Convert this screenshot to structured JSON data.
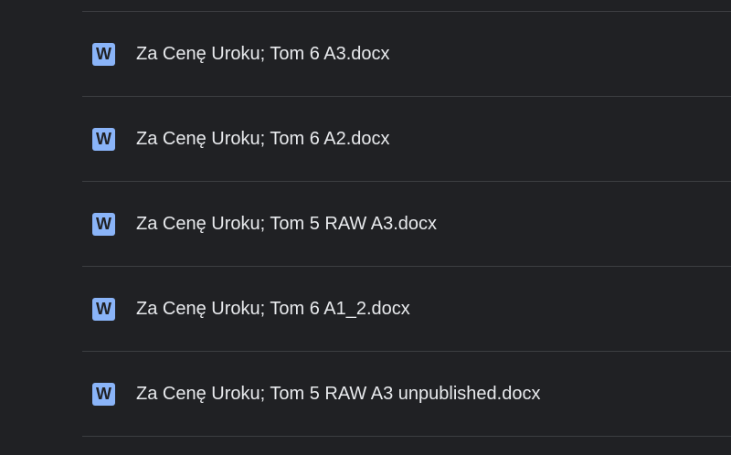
{
  "files": [
    {
      "name": "Za Cenę Uroku; Tom 6 A3.docx",
      "icon": "word-doc-icon",
      "icon_letter": "W"
    },
    {
      "name": "Za Cenę Uroku; Tom 6 A2.docx",
      "icon": "word-doc-icon",
      "icon_letter": "W"
    },
    {
      "name": "Za Cenę Uroku; Tom 5 RAW A3.docx",
      "icon": "word-doc-icon",
      "icon_letter": "W"
    },
    {
      "name": "Za Cenę Uroku; Tom 6 A1_2.docx",
      "icon": "word-doc-icon",
      "icon_letter": "W"
    },
    {
      "name": "Za Cenę Uroku; Tom 5 RAW A3 unpublished.docx",
      "icon": "word-doc-icon",
      "icon_letter": "W"
    }
  ],
  "colors": {
    "background": "#202124",
    "divider": "#3c3e42",
    "text": "#e8eaed",
    "word_icon": "#8ab4f8"
  }
}
